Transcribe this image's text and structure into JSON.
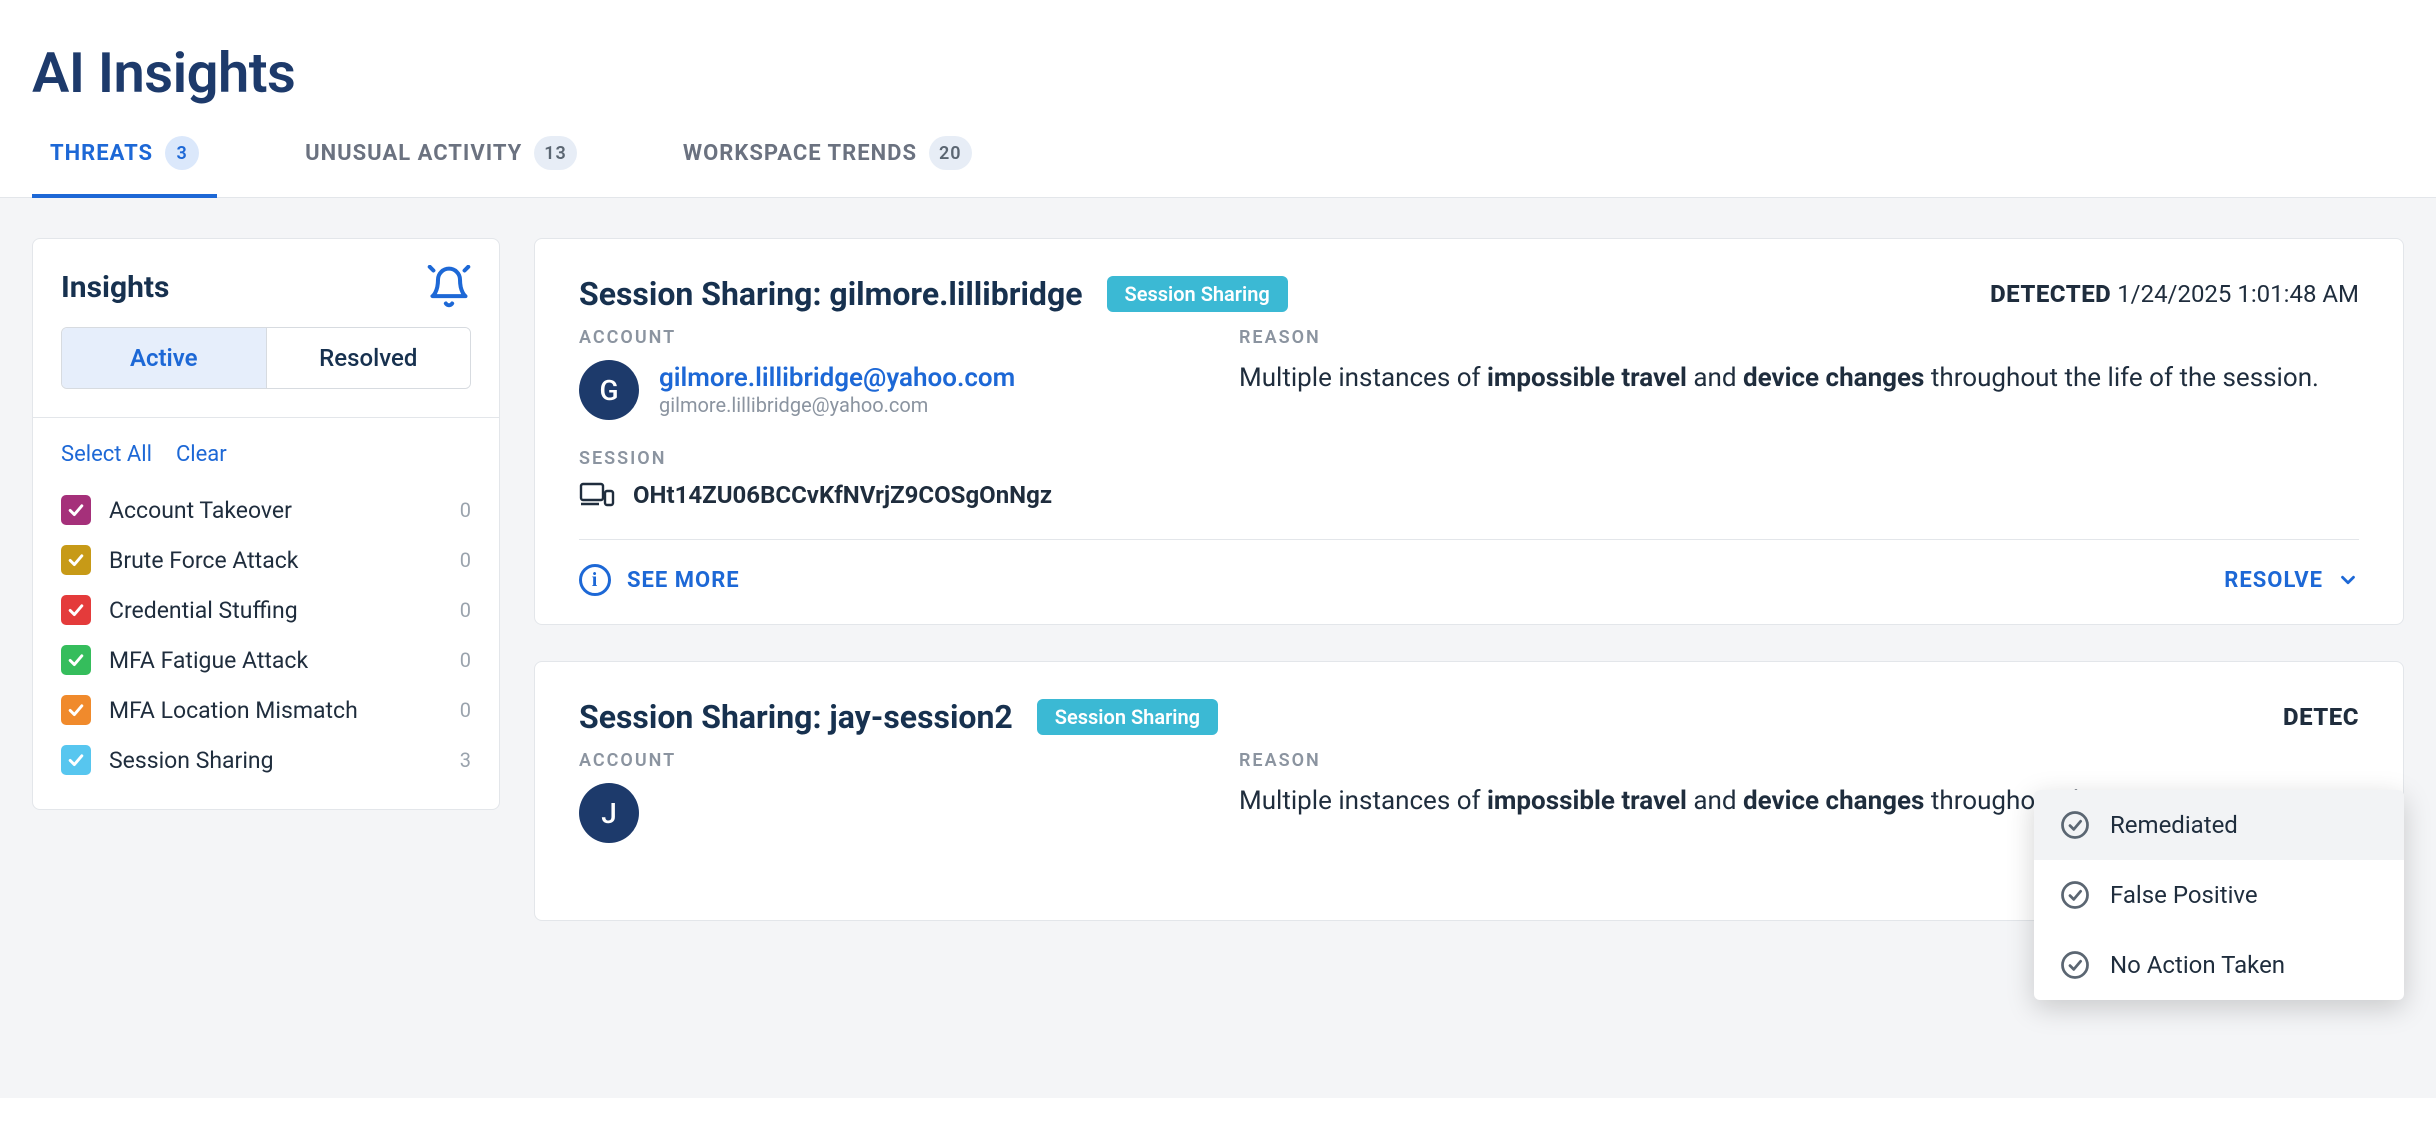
{
  "page_title": "AI Insights",
  "tabs": [
    {
      "label": "THREATS",
      "count": "3"
    },
    {
      "label": "UNUSUAL ACTIVITY",
      "count": "13"
    },
    {
      "label": "WORKSPACE TRENDS",
      "count": "20"
    }
  ],
  "sidebar": {
    "title": "Insights",
    "toggle": {
      "active": "Active",
      "resolved": "Resolved"
    },
    "select_all": "Select All",
    "clear": "Clear",
    "filters": [
      {
        "label": "Account Takeover",
        "count": "0",
        "color": "#a5307a"
      },
      {
        "label": "Brute Force Attack",
        "count": "0",
        "color": "#c79a17"
      },
      {
        "label": "Credential Stuffing",
        "count": "0",
        "color": "#e43b3b"
      },
      {
        "label": "MFA Fatigue Attack",
        "count": "0",
        "color": "#35bd5c"
      },
      {
        "label": "MFA Location Mismatch",
        "count": "0",
        "color": "#f08a2c"
      },
      {
        "label": "Session Sharing",
        "count": "3",
        "color": "#57c6ef"
      }
    ]
  },
  "cards": [
    {
      "title": "Session Sharing: gilmore.lillibridge",
      "chip": "Session Sharing",
      "detected_label": "DETECTED",
      "detected_time": "1/24/2025 1:01:48 AM",
      "account_label": "ACCOUNT",
      "avatar_initial": "G",
      "email": "gilmore.lillibridge@yahoo.com",
      "subemail": "gilmore.lillibridge@yahoo.com",
      "reason_label": "REASON",
      "reason_pre": "Multiple instances of ",
      "reason_b1": "impossible travel",
      "reason_mid": " and ",
      "reason_b2": "device changes",
      "reason_post": " throughout the life of the session.",
      "session_label": "SESSION",
      "session_id": "OHt14ZU06BCCvKfNVrjZ9COSgOnNgz",
      "see_more": "SEE MORE",
      "resolve": "RESOLVE"
    },
    {
      "title": "Session Sharing: jay-session2",
      "chip": "Session Sharing",
      "detected_label": "DETEC",
      "detected_time": "",
      "account_label": "ACCOUNT",
      "avatar_initial": "J",
      "email": "",
      "subemail": "",
      "reason_label": "REASON",
      "reason_pre": "Multiple instances of ",
      "reason_b1": "impossible travel",
      "reason_mid": " and ",
      "reason_b2": "device changes",
      "reason_post": " throughout the"
    }
  ],
  "resolve_menu": {
    "items": [
      "Remediated",
      "False Positive",
      "No Action Taken"
    ]
  }
}
